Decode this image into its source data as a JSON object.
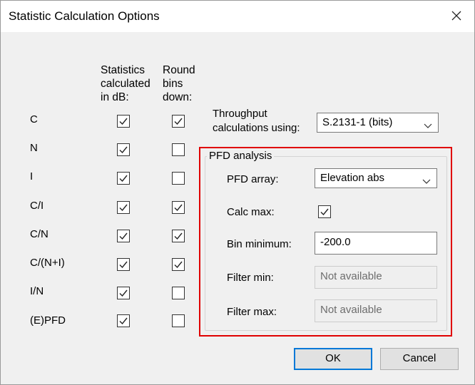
{
  "window": {
    "title": "Statistic Calculation Options",
    "close_icon": "close-icon"
  },
  "columns": {
    "stats_db": "Statistics\ncalculated\nin dB:",
    "round_bins": "Round\nbins\ndown:"
  },
  "rows": [
    {
      "label": "C",
      "stats_db": true,
      "round_down": true
    },
    {
      "label": "N",
      "stats_db": true,
      "round_down": false
    },
    {
      "label": "I",
      "stats_db": true,
      "round_down": false
    },
    {
      "label": "C/I",
      "stats_db": true,
      "round_down": true
    },
    {
      "label": "C/N",
      "stats_db": true,
      "round_down": true
    },
    {
      "label": "C/(N+I)",
      "stats_db": true,
      "round_down": true
    },
    {
      "label": "I/N",
      "stats_db": true,
      "round_down": false
    },
    {
      "label": "(E)PFD",
      "stats_db": true,
      "round_down": false
    }
  ],
  "throughput": {
    "label_line1": "Throughput",
    "label_line2": "calculations using:",
    "selected": "S.2131-1 (bits)"
  },
  "pfd": {
    "group_title": "PFD analysis",
    "array_label": "PFD array:",
    "array_selected": "Elevation abs",
    "calc_max_label": "Calc max:",
    "calc_max_checked": true,
    "bin_min_label": "Bin minimum:",
    "bin_min_value": "-200.0",
    "filter_min_label": "Filter min:",
    "filter_min_value": "Not available",
    "filter_max_label": "Filter max:",
    "filter_max_value": "Not available"
  },
  "buttons": {
    "ok": "OK",
    "cancel": "Cancel"
  },
  "colors": {
    "highlight": "#e00000",
    "default_button_border": "#0078d7"
  }
}
